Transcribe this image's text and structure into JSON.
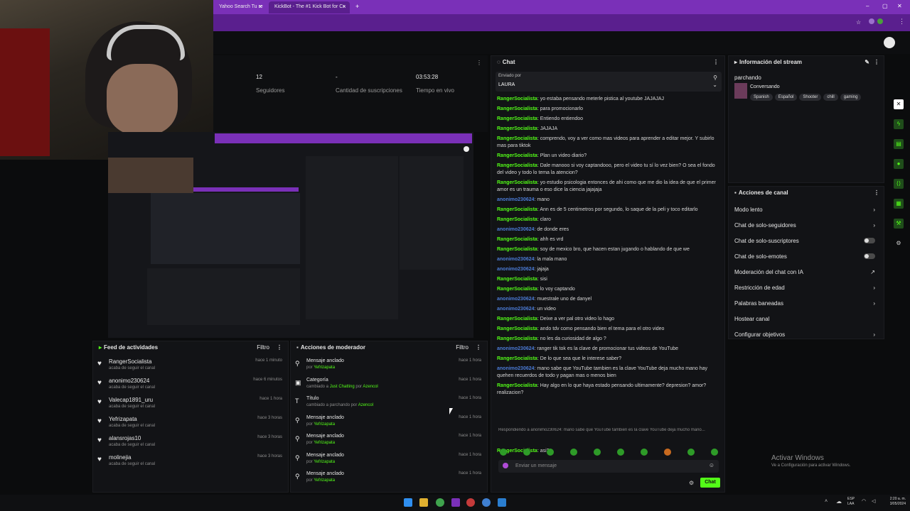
{
  "browser": {
    "tabs": [
      {
        "label": "Yahoo Search Tu re"
      },
      {
        "label": "KickBot - The #1 Kick Bot for Cr"
      }
    ],
    "close_label": "×",
    "new_tab_label": "+",
    "window_controls": [
      "–",
      "▢",
      "✕"
    ]
  },
  "stats": [
    {
      "value": "12",
      "label": "Seguidores"
    },
    {
      "value": "-",
      "label": "Cantidad de suscripciones"
    },
    {
      "value": "03:53:28",
      "label": "Tiempo en vivo"
    }
  ],
  "activity_feed": {
    "title": "Feed de actividades",
    "filter_label": "Filtro",
    "items": [
      {
        "name": "RangerSocialista",
        "sub": "acaba de seguir el canal",
        "time": "hace 1 minuto"
      },
      {
        "name": "anonimo230624",
        "sub": "acaba de seguir el canal",
        "time": "hace 6 minutos"
      },
      {
        "name": "Valecap1891_uru",
        "sub": "acaba de seguir el canal",
        "time": "hace 1 hora"
      },
      {
        "name": "Yefrizapata",
        "sub": "acaba de seguir el canal",
        "time": "hace 3 horas"
      },
      {
        "name": "alansrojas10",
        "sub": "acaba de seguir el canal",
        "time": "hace 3 horas"
      },
      {
        "name": "molinejia",
        "sub": "acaba de seguir el canal",
        "time": "hace 3 horas"
      }
    ]
  },
  "mod_actions": {
    "title": "Acciones de moderador",
    "filter_label": "Filtro",
    "items": [
      {
        "icon": "pin-icon",
        "name": "Mensaje anclado",
        "sub_pre": "por ",
        "sub_hl": "Yefrizapata",
        "sub_mid": "",
        "sub_hl2": "",
        "time": "hace 1 hora"
      },
      {
        "icon": "category-icon",
        "name": "Categoría",
        "sub_pre": "cambiado a ",
        "sub_hl": "Just Chatting",
        "sub_mid": " por ",
        "sub_hl2": "Azencol",
        "time": "hace 1 hora"
      },
      {
        "icon": "title-icon",
        "name": "Título",
        "sub_pre": "cambiado a ",
        "sub_hl": "",
        "sub_mid": "parchando por ",
        "sub_hl2": "Azencol",
        "time": "hace 1 hora"
      },
      {
        "icon": "pin-icon",
        "name": "Mensaje anclado",
        "sub_pre": "por ",
        "sub_hl": "Yefrizapata",
        "sub_mid": "",
        "sub_hl2": "",
        "time": "hace 1 hora"
      },
      {
        "icon": "pin-icon",
        "name": "Mensaje anclado",
        "sub_pre": "por ",
        "sub_hl": "Yefrizapata",
        "sub_mid": "",
        "sub_hl2": "",
        "time": "hace 1 hora"
      },
      {
        "icon": "pin-icon",
        "name": "Mensaje anclado",
        "sub_pre": "por ",
        "sub_hl": "Yefrizapata",
        "sub_mid": "",
        "sub_hl2": "",
        "time": "hace 1 hora"
      },
      {
        "icon": "pin-icon",
        "name": "Mensaje anclado",
        "sub_pre": "por ",
        "sub_hl": "Yefrizapata",
        "sub_mid": "",
        "sub_hl2": "",
        "time": "hace 1 hora"
      }
    ]
  },
  "chat": {
    "title": "Chat",
    "pinned_label": "Enviado por",
    "pinned_text": "LAURA",
    "messages": [
      {
        "user": "RangerSocialista",
        "blue": false,
        "text": "yo estaba pensando meterle pistica al youtube JAJAJAJ"
      },
      {
        "user": "RangerSocialista",
        "blue": false,
        "text": "para promocionarlo"
      },
      {
        "user": "RangerSocialista",
        "blue": false,
        "text": "Entiendo entiendoo"
      },
      {
        "user": "RangerSocialista",
        "blue": false,
        "text": "JAJAJA"
      },
      {
        "user": "RangerSocialista",
        "blue": false,
        "text": "comprendo, voy a ver como mas videos para aprender a editar mejor. Y subirlo mas para tiktok"
      },
      {
        "user": "RangerSocialista",
        "blue": false,
        "text": "Plan un video diario?"
      },
      {
        "user": "RangerSocialista",
        "blue": false,
        "text": "Dale manooo si voy captandooo, pero el video tu sí lo vez bien? O sea el fondo del video y todo lo tema la atencion?"
      },
      {
        "user": "RangerSocialista",
        "blue": false,
        "text": "yo estudio psicologia entonces de ahi como que me dio la idea de que el primer amor es un trauma o eso dice la ciencia jajajaja"
      },
      {
        "user": "anonimo230624",
        "blue": true,
        "text": "mano"
      },
      {
        "user": "RangerSocialista",
        "blue": false,
        "text": "Ann es de 5 centimetros por segundo, lo saque de la peli y toco editarlo"
      },
      {
        "user": "RangerSocialista",
        "blue": false,
        "text": "claro"
      },
      {
        "user": "anonimo230624",
        "blue": true,
        "text": "de donde eres"
      },
      {
        "user": "RangerSocialista",
        "blue": false,
        "text": "ahh es vrd"
      },
      {
        "user": "RangerSocialista",
        "blue": false,
        "text": "soy de mexico bro, que hacen estan jugando o hablando de que we"
      },
      {
        "user": "anonimo230624",
        "blue": true,
        "text": "la mala mano"
      },
      {
        "user": "anonimo230624",
        "blue": true,
        "text": "jajaja"
      },
      {
        "user": "RangerSocialista",
        "blue": false,
        "text": "sisi"
      },
      {
        "user": "RangerSocialista",
        "blue": false,
        "text": "lo voy captando"
      },
      {
        "user": "anonimo230624",
        "blue": true,
        "text": "muestrale uno de danyel"
      },
      {
        "user": "anonimo230624",
        "blue": true,
        "text": "un video"
      },
      {
        "user": "RangerSocialista",
        "blue": false,
        "text": "Deixe a ver pal otro video lo hago"
      },
      {
        "user": "RangerSocialista",
        "blue": false,
        "text": "ando tdv como pensando bien el tema para el otro video"
      },
      {
        "user": "RangerSocialista",
        "blue": false,
        "text": "no les da curiosidad de algo ?"
      },
      {
        "user": "anonimo230624",
        "blue": true,
        "text": "ranger tik tok es la clave de promocionar tus videos de YouTube"
      },
      {
        "user": "RangerSocialista",
        "blue": false,
        "text": "De lo que sea que le interese saber?"
      },
      {
        "user": "anonimo230624",
        "blue": true,
        "text": "mano sabe que YouTube tambien es la clave YouTube deja mucho mano hay quehen recuerdos de todo y pagan mas o menos bien"
      },
      {
        "user": "RangerSocialista",
        "blue": false,
        "text": "Hay algo en lo que haya estado pensando ultimamente? depresion? amor? realizacion?"
      }
    ],
    "reply_hint": "Respondiendo a anonimo230624: mano sabe que YouTube tambien es la clave YouTube deja mucho mano...",
    "last_user": "RangerSocialista",
    "last_text": "asi?",
    "input_placeholder": "Enviar un mensaje",
    "send_label": "Chat"
  },
  "stream_info": {
    "title": "Información del stream",
    "stream_title": "parchando",
    "category": "Conversando",
    "tags": [
      "Spanish",
      "Español",
      "Shooter",
      "chill",
      "gaming"
    ]
  },
  "channel_actions": {
    "title": "Acciones de canal",
    "items": [
      {
        "label": "Modo lento",
        "control": "arrow"
      },
      {
        "label": "Chat de solo-seguidores",
        "control": "arrow"
      },
      {
        "label": "Chat de solo-suscriptores",
        "control": "toggle"
      },
      {
        "label": "Chat de solo-emotes",
        "control": "toggle"
      },
      {
        "label": "Moderación del chat con IA",
        "control": "ext"
      },
      {
        "label": "Restricción de edad",
        "control": "arrow"
      },
      {
        "label": "Palabras baneadas",
        "control": "arrow"
      },
      {
        "label": "Hostear canal",
        "control": "none"
      },
      {
        "label": "Configurar objetivos",
        "control": "arrow"
      }
    ]
  },
  "watermark": {
    "title": "Activar Windows",
    "sub": "Ve a Configuración para activar Windows."
  },
  "taskbar": {
    "lang1": "ESP",
    "lang2": "LAA",
    "time": "2:20 a. m.",
    "date": "3/05/2024"
  },
  "colors": {
    "accent": "#53fc18",
    "purple": "#7a30b8",
    "blue_user": "#4b7bd6"
  }
}
